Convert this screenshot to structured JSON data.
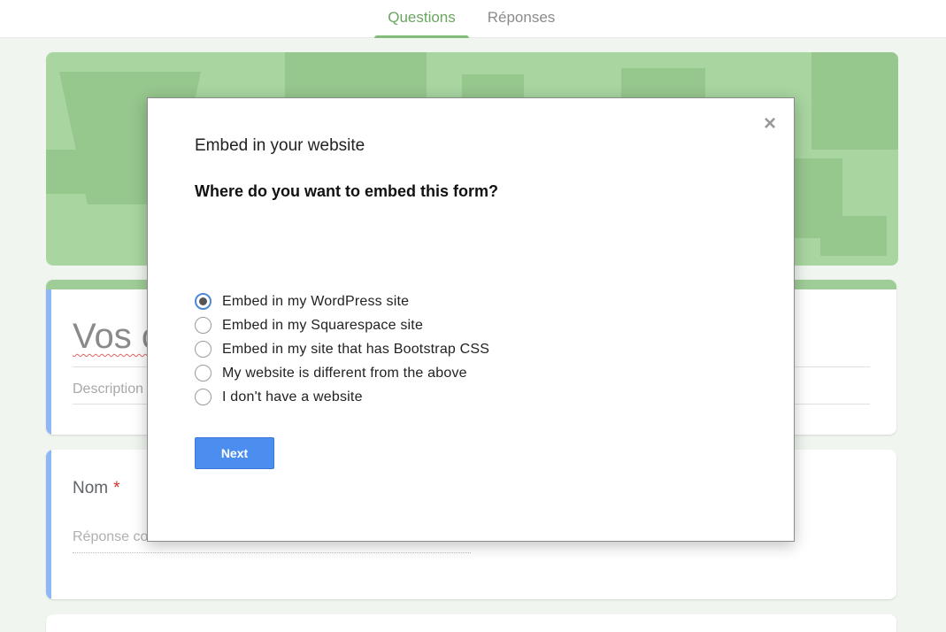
{
  "tabs": {
    "questions": "Questions",
    "responses": "Réponses"
  },
  "form": {
    "title": "Vos c",
    "description_placeholder": "Description",
    "question_label": "Nom",
    "required_mark": "*",
    "answer_placeholder": "Réponse courte"
  },
  "modal": {
    "title": "Embed in your website",
    "question": "Where do you want to embed this form?",
    "close_icon": "close-icon",
    "options": [
      {
        "label": "Embed in my WordPress site",
        "selected": true
      },
      {
        "label": "Embed in my Squarespace site",
        "selected": false
      },
      {
        "label": "Embed in my site that has Bootstrap CSS",
        "selected": false
      },
      {
        "label": "My website is different from the above",
        "selected": false
      },
      {
        "label": "I don't have a website",
        "selected": false
      }
    ],
    "next_label": "Next"
  },
  "colors": {
    "accent_green": "#83bb78",
    "banner": "#a8d5a0",
    "button_blue": "#4c8ef0",
    "stripe_blue": "#8fb7f4"
  }
}
